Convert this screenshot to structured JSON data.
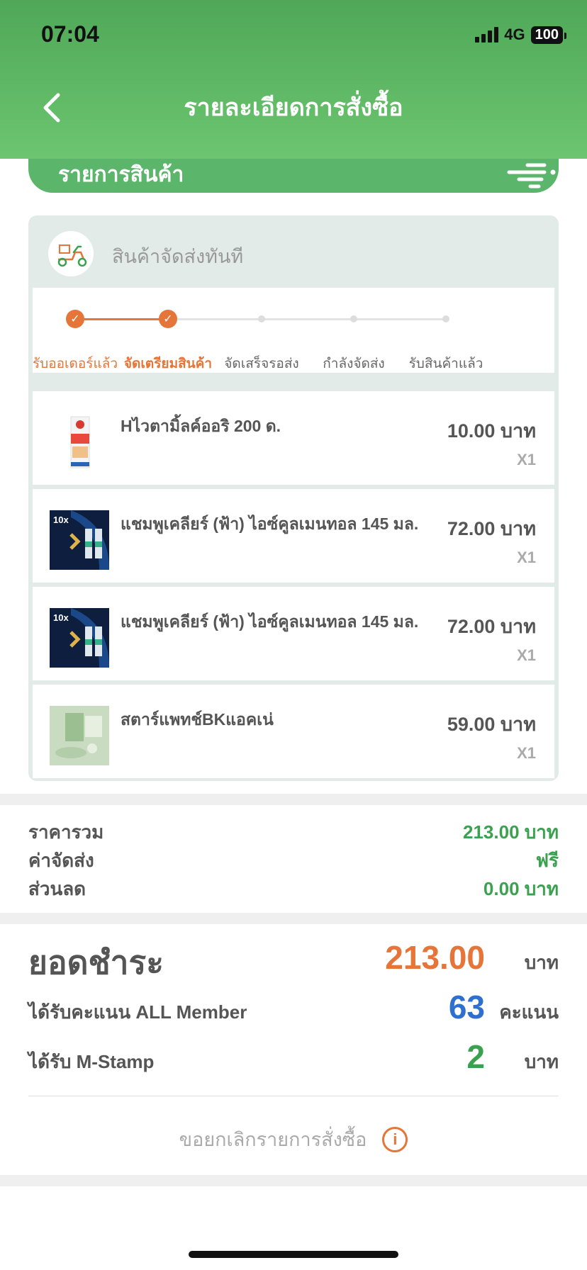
{
  "status_bar": {
    "time": "07:04",
    "network": "4G",
    "battery": "100"
  },
  "header": {
    "title": "รายละเอียดการสั่งซื้อ",
    "back_icon": "chevron-left-icon"
  },
  "section": {
    "title": "รายการสินค้า"
  },
  "shipping": {
    "label": "สินค้าจัดส่งทันที",
    "icon": "scooter-icon"
  },
  "tracker": {
    "steps": [
      "รับออเดอร์แล้ว",
      "จัดเตรียมสินค้า",
      "จัดเสร็จรอส่ง",
      "กำลังจัดส่ง",
      "รับสินค้าแล้ว"
    ],
    "completed_steps": 2,
    "current_step": 2
  },
  "items": [
    {
      "name": "Hไวตามิ้ลค์ออริ 200 ด.",
      "price": "10.00 บาท",
      "qty": "X1",
      "icon": "milk-carton-image"
    },
    {
      "name": "แชมพูเคลียร์ (ฟ้า) ไอซ์คูลเมนทอล 145 มล.",
      "price": "72.00 บาท",
      "qty": "X1",
      "icon": "shampoo-image"
    },
    {
      "name": "แชมพูเคลียร์ (ฟ้า) ไอซ์คูลเมนทอล 145 มล.",
      "price": "72.00 บาท",
      "qty": "X1",
      "icon": "shampoo-image"
    },
    {
      "name": "สตาร์แพทช์BKแอคเน่",
      "price": "59.00 บาท",
      "qty": "X1",
      "icon": "acne-patch-image"
    }
  ],
  "summary": {
    "subtotal_label": "ราคารวม",
    "subtotal_value": "213.00 บาท",
    "shipping_label": "ค่าจัดส่ง",
    "shipping_value": "ฟรี",
    "discount_label": "ส่วนลด",
    "discount_value": "0.00 บาท"
  },
  "payment": {
    "label": "ยอดชำระ",
    "amount": "213.00",
    "unit": "บาท",
    "points_label": "ได้รับคะแนน ALL Member",
    "points_value": "63",
    "points_unit": "คะแนน",
    "stamp_label": "ได้รับ M-Stamp",
    "stamp_value": "2",
    "stamp_unit": "บาท"
  },
  "cancel": {
    "label": "ขอยกเลิกรายการสั่งซื้อ",
    "icon": "info-icon"
  },
  "colors": {
    "brand_green": "#5bb56b",
    "accent_orange": "#e57538",
    "points_blue": "#2f6fce",
    "value_green": "#3aa24f"
  }
}
